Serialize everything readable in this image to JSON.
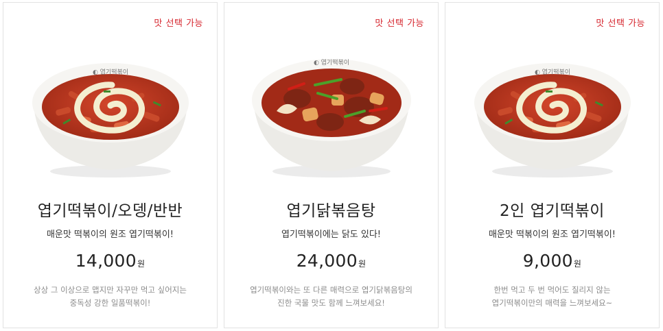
{
  "colors": {
    "badge": "#d6262e",
    "card_border": "#e2e2e2",
    "sauce": "#b8321c",
    "bowl": "#f3f1ee"
  },
  "cards": [
    {
      "badge": "맛 선택 가능",
      "title": "엽기떡볶이/오뎅/반반",
      "subtitle": "매운맛 떡볶이의 원조 엽기떡볶이!",
      "price": "14,000",
      "unit": "원",
      "desc_line1": "상상 그 이상으로 맵지만 자꾸만 먹고 싶어지는",
      "desc_line2": "중독성 강한 일품떡볶이!",
      "image": "tteokbokki-with-cheese-bowl"
    },
    {
      "badge": "맛 선택 가능",
      "title": "엽기닭볶음탕",
      "subtitle": "엽기떡볶이에는 닭도 있다!",
      "price": "24,000",
      "unit": "원",
      "desc_line1": "엽기떡볶이와는 또 다른 매력으로 엽기닭볶음탕의",
      "desc_line2": "진한 국물 맛도 함께 느껴보세요!",
      "image": "spicy-braised-chicken-bowl"
    },
    {
      "badge": "맛 선택 가능",
      "title": "2인 엽기떡볶이",
      "subtitle": "매운맛 떡볶이의 원조 엽기떡볶이!",
      "price": "9,000",
      "unit": "원",
      "desc_line1": "한번 먹고 두 번 먹어도 질리지 않는",
      "desc_line2": "엽기떡볶이만의 매력을 느껴보세요~",
      "image": "tteokbokki-with-cheese-bowl"
    }
  ]
}
